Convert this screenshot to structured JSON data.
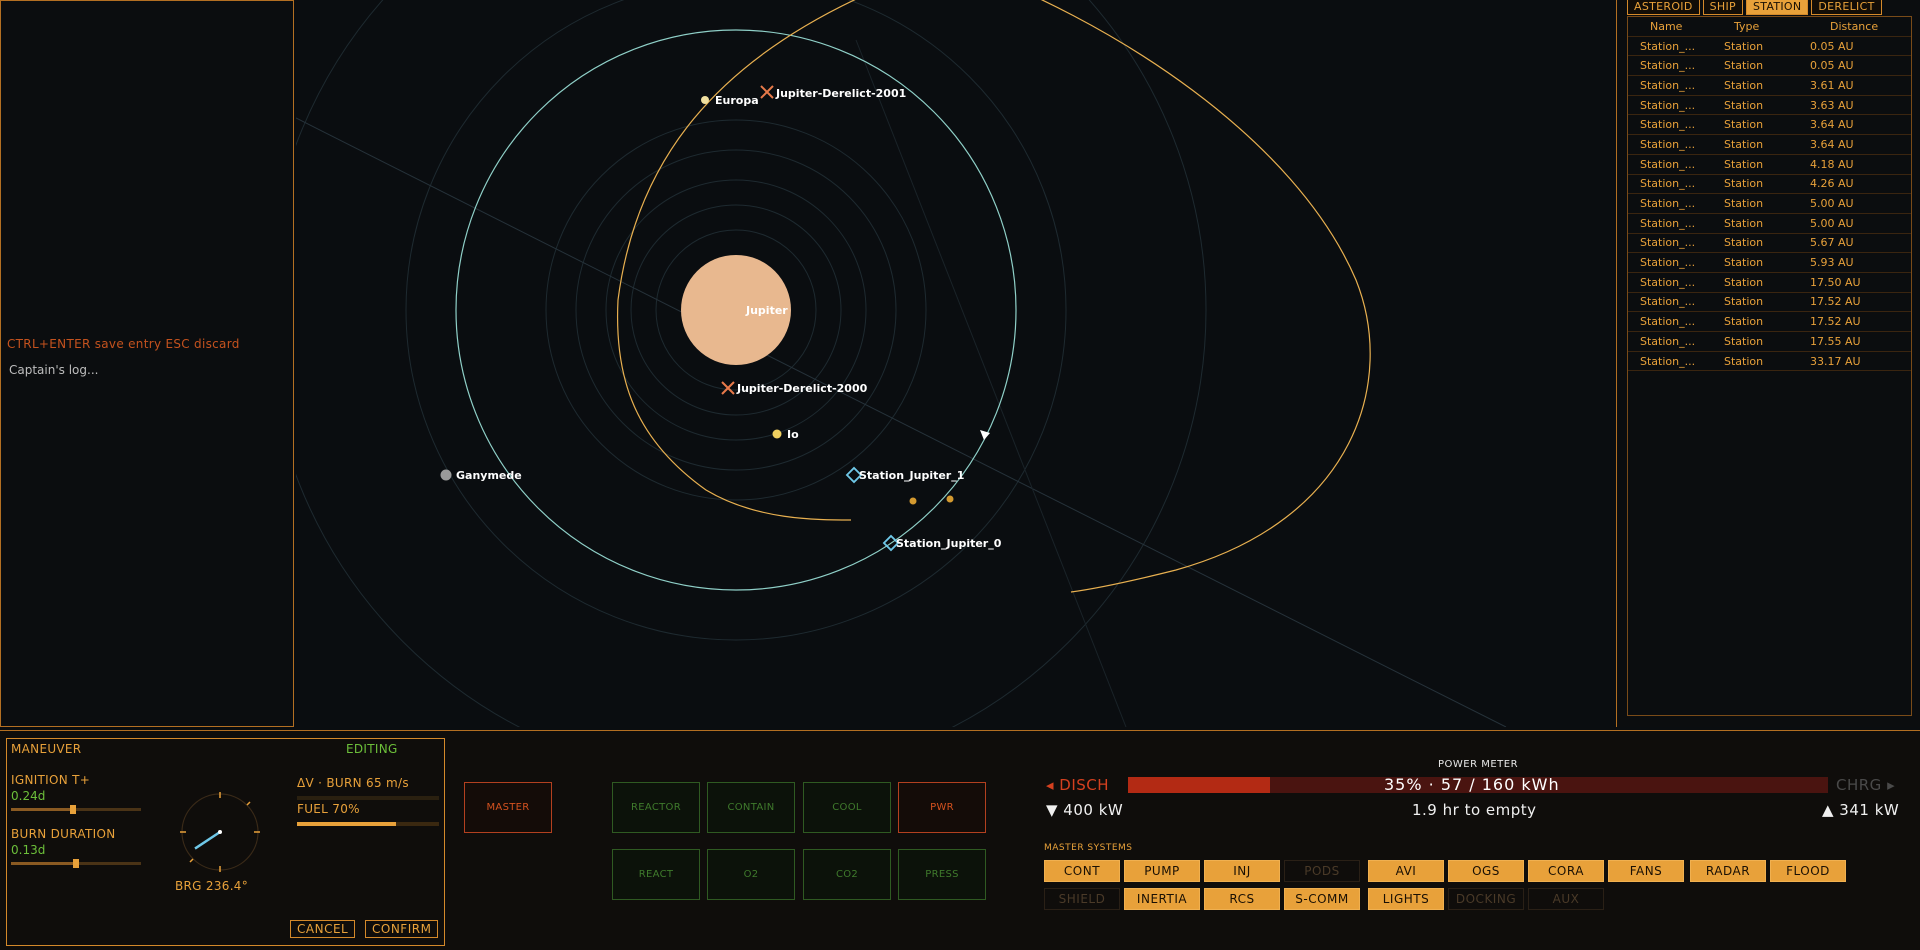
{
  "log": {
    "hint": "CTRL+ENTER save entry  ESC discard",
    "placeholder": "Captain's log..."
  },
  "map": {
    "bodies": [
      {
        "name": "Jupiter",
        "kind": "planet"
      },
      {
        "name": "Europa",
        "kind": "moon"
      },
      {
        "name": "Io",
        "kind": "moon"
      },
      {
        "name": "Ganymede",
        "kind": "moon"
      },
      {
        "name": "Jupiter-Derelict-2001",
        "kind": "derelict"
      },
      {
        "name": "Jupiter-Derelict-2000",
        "kind": "derelict"
      },
      {
        "name": "Station_Jupiter_1",
        "kind": "station"
      },
      {
        "name": "Station_Jupiter_0",
        "kind": "station"
      }
    ]
  },
  "contacts": {
    "tabs": [
      {
        "label": "ASTEROID",
        "active": false
      },
      {
        "label": "SHIP",
        "active": false
      },
      {
        "label": "STATION",
        "active": true
      },
      {
        "label": "DERELICT",
        "active": false
      }
    ],
    "headers": {
      "name": "Name",
      "type": "Type",
      "distance": "Distance"
    },
    "rows": [
      {
        "name": "Station_...",
        "type": "Station",
        "distance": "0.05 AU"
      },
      {
        "name": "Station_...",
        "type": "Station",
        "distance": "0.05 AU"
      },
      {
        "name": "Station_...",
        "type": "Station",
        "distance": "3.61 AU"
      },
      {
        "name": "Station_...",
        "type": "Station",
        "distance": "3.63 AU"
      },
      {
        "name": "Station_...",
        "type": "Station",
        "distance": "3.64 AU"
      },
      {
        "name": "Station_...",
        "type": "Station",
        "distance": "3.64 AU"
      },
      {
        "name": "Station_...",
        "type": "Station",
        "distance": "4.18 AU"
      },
      {
        "name": "Station_...",
        "type": "Station",
        "distance": "4.26 AU"
      },
      {
        "name": "Station_...",
        "type": "Station",
        "distance": "5.00 AU"
      },
      {
        "name": "Station_...",
        "type": "Station",
        "distance": "5.00 AU"
      },
      {
        "name": "Station_...",
        "type": "Station",
        "distance": "5.67 AU"
      },
      {
        "name": "Station_...",
        "type": "Station",
        "distance": "5.93 AU"
      },
      {
        "name": "Station_...",
        "type": "Station",
        "distance": "17.50 AU"
      },
      {
        "name": "Station_...",
        "type": "Station",
        "distance": "17.52 AU"
      },
      {
        "name": "Station_...",
        "type": "Station",
        "distance": "17.52 AU"
      },
      {
        "name": "Station_...",
        "type": "Station",
        "distance": "17.55 AU"
      },
      {
        "name": "Station_...",
        "type": "Station",
        "distance": "33.17 AU"
      }
    ]
  },
  "maneuver": {
    "title": "MANEUVER",
    "status": "EDITING",
    "ignition_label": "IGNITION T+",
    "ignition_value": "0.24d",
    "ignition_level": 0.48,
    "burn_label": "BURN DURATION",
    "burn_value": "0.13d",
    "burn_level": 0.5,
    "dv_label": "ΔV · BURN 65 m/s",
    "fuel_label": "FUEL 70%",
    "fuel_level": 0.7,
    "bearing_label": "BRG 236.4°",
    "bearing_deg": 236.4,
    "cancel": "CANCEL",
    "confirm": "CONFIRM"
  },
  "systems": {
    "master": "MASTER",
    "row1": [
      {
        "label": "REACTOR",
        "state": "green"
      },
      {
        "label": "CONTAIN",
        "state": "green"
      },
      {
        "label": "COOL",
        "state": "green"
      },
      {
        "label": "PWR",
        "state": "red"
      }
    ],
    "row2": [
      {
        "label": "REACT",
        "state": "green"
      },
      {
        "label": "O2",
        "state": "green"
      },
      {
        "label": "CO2",
        "state": "green"
      },
      {
        "label": "PRESS",
        "state": "green"
      }
    ]
  },
  "power": {
    "title": "POWER METER",
    "disch": "◂ DISCH",
    "chrg": "CHRG ▸",
    "readout": "35% · 57 / 160 kWh",
    "level": 0.35,
    "draw": "▼ 400 kW",
    "time_to_empty": "1.9 hr to empty",
    "generation": "▲ 341 kW"
  },
  "master_systems": {
    "title": "MASTER SYSTEMS",
    "row1": [
      {
        "label": "CONT",
        "on": true
      },
      {
        "label": "PUMP",
        "on": true
      },
      {
        "label": "INJ",
        "on": true
      },
      {
        "label": "PODS",
        "on": false
      },
      {
        "label": "AVI",
        "on": true
      },
      {
        "label": "OGS",
        "on": true
      },
      {
        "label": "CORA",
        "on": true
      },
      {
        "label": "FANS",
        "on": true
      },
      {
        "label": "RADAR",
        "on": true
      },
      {
        "label": "FLOOD",
        "on": true
      }
    ],
    "row2": [
      {
        "label": "SHIELD",
        "on": false
      },
      {
        "label": "INERTIA",
        "on": true
      },
      {
        "label": "RCS",
        "on": true
      },
      {
        "label": "S-COMM",
        "on": true
      },
      {
        "label": "LIGHTS",
        "on": true
      },
      {
        "label": "DOCKING",
        "on": false
      },
      {
        "label": "AUX",
        "on": false
      }
    ]
  },
  "colors": {
    "accent": "#e8a13a",
    "orbit": "#8fd0c8",
    "trajectory": "#e8b050",
    "planet": "#e8b88f",
    "station": "#6fc8e8",
    "derelict": "#e87a4a"
  }
}
